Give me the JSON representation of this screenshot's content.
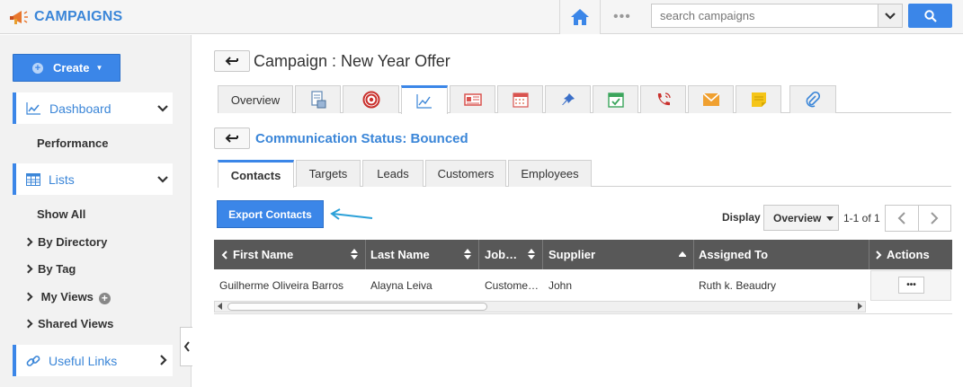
{
  "app": {
    "name": "CAMPAIGNS"
  },
  "topbar": {
    "home_icon": "home-icon",
    "more_dots": "•••",
    "search": {
      "placeholder": "search campaigns",
      "value": ""
    }
  },
  "sidebar": {
    "create_label": "Create",
    "dashboard": {
      "label": "Dashboard",
      "sub": [
        "Performance"
      ]
    },
    "lists": {
      "label": "Lists",
      "sub": [
        "Show All",
        "By Directory",
        "By Tag",
        "My Views",
        "Shared Views"
      ]
    },
    "useful_links": {
      "label": "Useful Links"
    }
  },
  "header": {
    "title": "Campaign : New Year Offer"
  },
  "tabs": [
    {
      "label": "Overview",
      "icon": null
    },
    {
      "icon": "document-icon"
    },
    {
      "icon": "target-icon"
    },
    {
      "icon": "chart-icon",
      "active": true
    },
    {
      "icon": "newspaper-icon"
    },
    {
      "icon": "calendar-icon"
    },
    {
      "icon": "pin-icon"
    },
    {
      "icon": "task-check-icon"
    },
    {
      "icon": "phone-icon"
    },
    {
      "icon": "mail-icon"
    },
    {
      "icon": "note-icon"
    },
    {
      "icon": "paperclip-icon"
    }
  ],
  "section": {
    "title": "Communication Status: Bounced"
  },
  "subtabs": [
    "Contacts",
    "Targets",
    "Leads",
    "Customers",
    "Employees"
  ],
  "toolbar": {
    "export_label": "Export Contacts",
    "display_label": "Display",
    "display_value": "Overview",
    "pager_text": "1-1 of 1"
  },
  "grid": {
    "columns": [
      "First Name",
      "Last Name",
      "Job…",
      "Supplier",
      "Assigned To",
      "Actions"
    ],
    "rows": [
      {
        "first_name": "Guilherme Oliveira Barros",
        "last_name": "Alayna Leiva",
        "job": "Custome…",
        "supplier": "John",
        "assigned_to": "Ruth k. Beaudry",
        "actions": "•••"
      }
    ]
  },
  "colors": {
    "accent": "#3b86e8",
    "header_bg": "#585858",
    "sidebar_bg": "#f2f2f2"
  }
}
